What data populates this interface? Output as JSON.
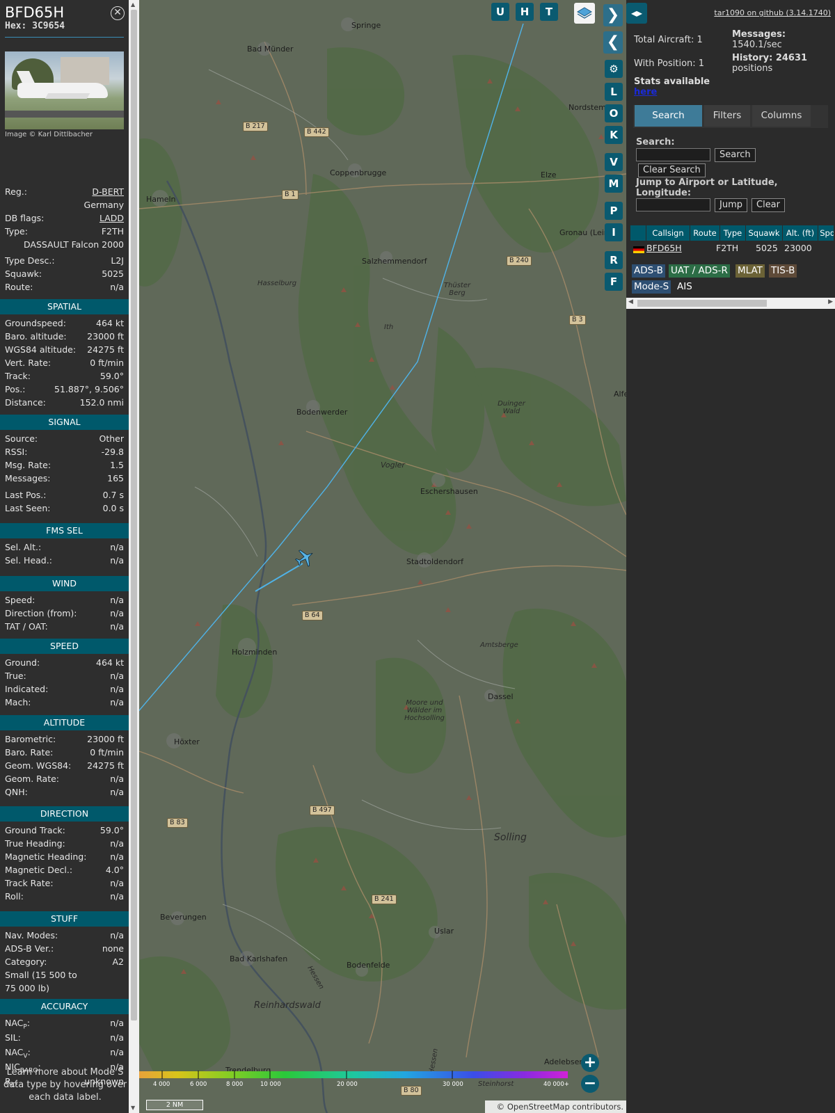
{
  "detail": {
    "callsign": "BFD65H",
    "hex": "Hex: 3C9654",
    "image_credit": "Image © Karl Dittlbacher",
    "rows_top": [
      {
        "k": "Reg.:",
        "v": "D-BERT",
        "link": true
      },
      {
        "k": "",
        "v": "Germany"
      },
      {
        "k": "DB flags:",
        "v": "LADD",
        "link": true
      },
      {
        "k": "Type:",
        "v": "F2TH"
      },
      {
        "k": "",
        "v": "DASSAULT Falcon 2000"
      },
      {
        "k": "Type Desc.:",
        "v": "L2J"
      },
      {
        "k": "Squawk:",
        "v": "5025"
      },
      {
        "k": "Route:",
        "v": "n/a"
      }
    ],
    "sections": [
      {
        "title": "SPATIAL",
        "rows": [
          {
            "k": "Groundspeed:",
            "v": "464 kt"
          },
          {
            "k": "Baro. altitude:",
            "v": "23000 ft"
          },
          {
            "k": "WGS84 altitude:",
            "v": "24275 ft"
          },
          {
            "k": "Vert. Rate:",
            "v": "0 ft/min"
          },
          {
            "k": "Track:",
            "v": "59.0°"
          },
          {
            "k": "Pos.:",
            "v": "51.887°, 9.506°"
          },
          {
            "k": "Distance:",
            "v": "152.0 nmi"
          }
        ]
      },
      {
        "title": "SIGNAL",
        "rows": [
          {
            "k": "Source:",
            "v": "Other"
          },
          {
            "k": "RSSI:",
            "v": "-29.8"
          },
          {
            "k": "Msg. Rate:",
            "v": "1.5"
          },
          {
            "k": "Messages:",
            "v": "165"
          },
          {
            "k": "Last Pos.:",
            "v": "0.7 s"
          },
          {
            "k": "Last Seen:",
            "v": "0.0 s"
          }
        ]
      },
      {
        "title": "FMS SEL",
        "rows": [
          {
            "k": "Sel. Alt.:",
            "v": "n/a"
          },
          {
            "k": "Sel. Head.:",
            "v": "n/a"
          }
        ]
      },
      {
        "title": "WIND",
        "rows": [
          {
            "k": "Speed:",
            "v": "n/a"
          },
          {
            "k": "Direction (from):",
            "v": "n/a"
          },
          {
            "k": "TAT / OAT:",
            "v": "n/a"
          }
        ]
      },
      {
        "title": "SPEED",
        "rows": [
          {
            "k": "Ground:",
            "v": "464 kt"
          },
          {
            "k": "True:",
            "v": "n/a"
          },
          {
            "k": "Indicated:",
            "v": "n/a"
          },
          {
            "k": "Mach:",
            "v": "n/a"
          }
        ]
      },
      {
        "title": "ALTITUDE",
        "rows": [
          {
            "k": "Barometric:",
            "v": "23000 ft"
          },
          {
            "k": "Baro. Rate:",
            "v": "0 ft/min"
          },
          {
            "k": "Geom. WGS84:",
            "v": "24275 ft"
          },
          {
            "k": "Geom. Rate:",
            "v": "n/a"
          },
          {
            "k": "QNH:",
            "v": "n/a"
          }
        ]
      },
      {
        "title": "DIRECTION",
        "rows": [
          {
            "k": "Ground Track:",
            "v": "59.0°"
          },
          {
            "k": "True Heading:",
            "v": "n/a"
          },
          {
            "k": "Magnetic Heading:",
            "v": "n/a"
          },
          {
            "k": "Magnetic Decl.:",
            "v": "4.0°"
          },
          {
            "k": "Track Rate:",
            "v": "n/a"
          },
          {
            "k": "Roll:",
            "v": "n/a"
          }
        ]
      },
      {
        "title": "STUFF",
        "rows": [
          {
            "k": "Nav. Modes:",
            "v": "n/a"
          },
          {
            "k": "ADS-B Ver.:",
            "v": "none"
          },
          {
            "k": "Category:",
            "v": "A2"
          },
          {
            "k": "Small (15 500 to",
            "v": ""
          },
          {
            "k": "75 000 lb)",
            "v": ""
          }
        ]
      },
      {
        "title": "ACCURACY",
        "rows": [
          {
            "k": "NACP:",
            "v": "n/a"
          },
          {
            "k": "SIL:",
            "v": "n/a"
          },
          {
            "k": "NACV:",
            "v": "n/a"
          },
          {
            "k": "NICBARO:",
            "v": "n/a"
          },
          {
            "k": "RC:",
            "v": "unknown"
          }
        ]
      }
    ],
    "learn_more": "Learn more about Mode S data type by hovering over each data label."
  },
  "map": {
    "buttons_top": [
      "U",
      "H",
      "T"
    ],
    "buttons_side": [
      "L",
      "O",
      "K",
      "V",
      "M",
      "P",
      "I",
      "R",
      "F"
    ],
    "towns": [
      "Springe",
      "Bad Münder",
      "Nordstem",
      "Coppenbrugge",
      "Hameln",
      "Elze",
      "Gronau (Lein",
      "Salzhemmendorf",
      "Bodenwerder",
      "Eschershausen",
      "Stadtoldendorf",
      "Holzminden",
      "Dassel",
      "Höxter",
      "Beverungen",
      "Uslar",
      "Bad Karlshafen",
      "Bodenfelde",
      "Adelebsen",
      "Trendelburg",
      "Alfe"
    ],
    "features": [
      "Hasselburg",
      "Thüster Berg",
      "Ith",
      "Vogler",
      "Duinger Wald",
      "Amtsberge",
      "Moore und Wälder im Hochsolling",
      "Solling",
      "Reinhardswald",
      "Hessen",
      "Steinhorst",
      "Hessen"
    ],
    "roads": [
      "B 217",
      "B 442",
      "B 1",
      "B 240",
      "B 3",
      "B 64",
      "B 497",
      "B 83",
      "B 241",
      "B 80"
    ],
    "altitude_labels": [
      "4 000",
      "6 000",
      "8 000",
      "10 000",
      "20 000",
      "30 000",
      "40 000+"
    ],
    "scale": "2 NM",
    "attribution": "© OpenStreetMap contributors."
  },
  "panel": {
    "github": "tar1090 on github (3.14.1740)",
    "total_aircraft": "Total Aircraft: 1",
    "with_position": "With Position: 1",
    "messages_label": "Messages:",
    "messages_value": "1540.1/sec",
    "history_label": "History: 24631",
    "history_value": "positions",
    "stats": "Stats available",
    "stats_link": "here",
    "tabs": [
      "Search",
      "Filters",
      "Columns"
    ],
    "search_label": "Search:",
    "search_button": "Search",
    "clear_search_button": "Clear Search",
    "jump_label": "Jump to Airport or Latitude, Longitude:",
    "jump_button": "Jump",
    "clear_button": "Clear",
    "table": {
      "headers": [
        "",
        "Callsign",
        "Route",
        "Type",
        "Squawk",
        "Alt. (ft)",
        "Spd."
      ],
      "row": [
        "",
        "BFD65H",
        "",
        "F2TH",
        "5025",
        "23000",
        ""
      ]
    },
    "chips": [
      {
        "label": "ADS-B",
        "color": "#2e4f72"
      },
      {
        "label": "UAT / ADS-R",
        "color": "#2c6d46"
      },
      {
        "label": "MLAT",
        "color": "#6b6236"
      },
      {
        "label": "TIS-B",
        "color": "#5e4a38"
      },
      {
        "label": "Mode-S",
        "color": "#2e4f72"
      },
      {
        "label": "AIS",
        "color": ""
      }
    ]
  }
}
